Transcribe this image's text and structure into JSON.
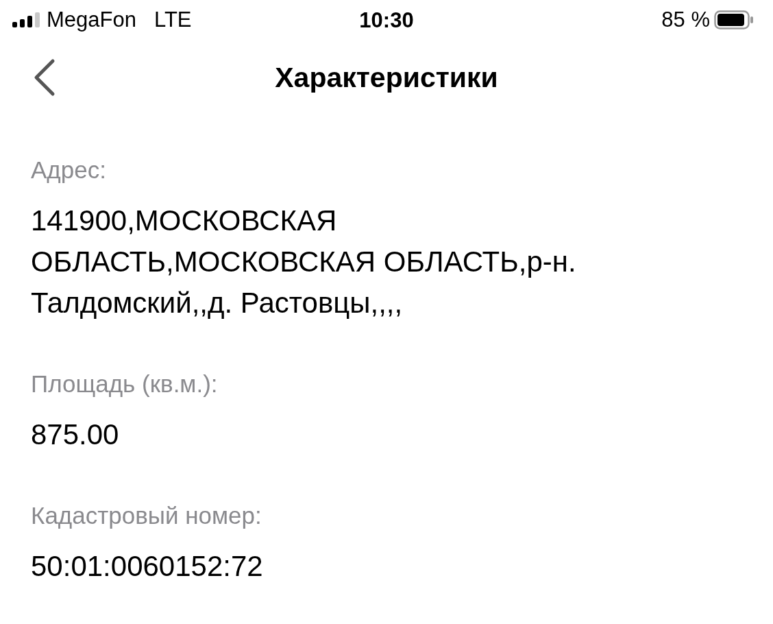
{
  "status_bar": {
    "carrier": "MegaFon",
    "network": "LTE",
    "time": "10:30",
    "battery": "85 %"
  },
  "nav": {
    "title": "Характеристики"
  },
  "fields": [
    {
      "label": "Адрес:",
      "value": "141900,МОСКОВСКАЯ ОБЛАСТЬ,МОСКОВСКАЯ ОБЛАСТЬ,р-н. Талдомский,,д. Растовцы,,,,"
    },
    {
      "label": "Площадь (кв.м.):",
      "value": "875.00"
    },
    {
      "label": "Кадастровый номер:",
      "value": "50:01:0060152:72"
    }
  ]
}
